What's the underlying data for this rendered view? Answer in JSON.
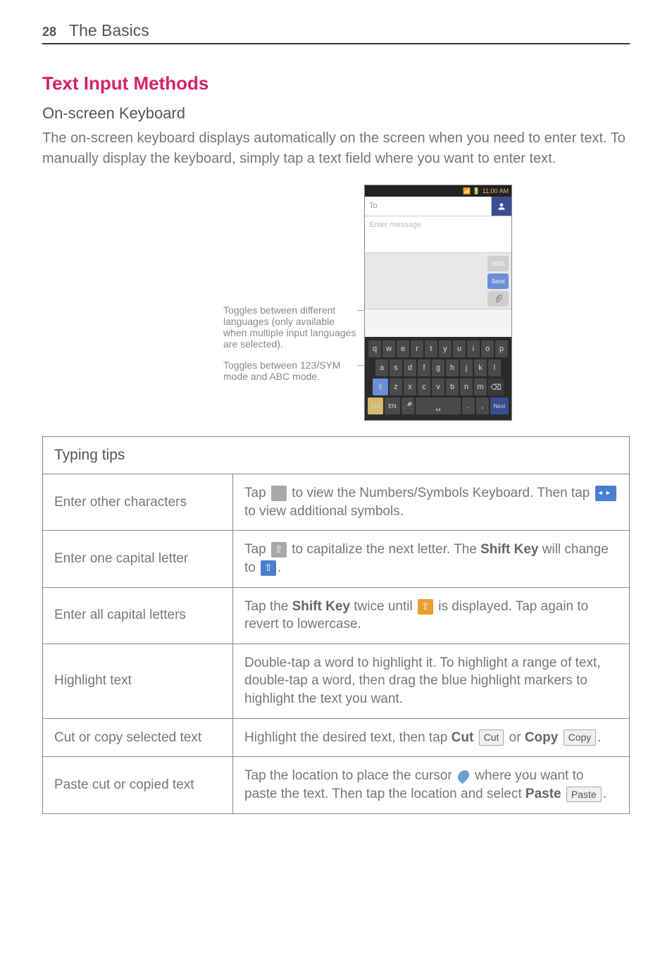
{
  "page_number": "28",
  "section_title": "The Basics",
  "heading": "Text Input Methods",
  "sub_heading": "On-screen Keyboard",
  "intro": "The on-screen keyboard displays automatically on the screen when you need to enter text. To manually display the keyboard, simply tap a text field where you want to enter text.",
  "annotations": {
    "lang": "Toggles between different languages (only available when multiple input languages are selected).",
    "sym": "Toggles between 123/SYM mode and ABC mode."
  },
  "phone": {
    "status_time": "11:00 AM",
    "to_placeholder": "To",
    "msg_placeholder": "Enter message",
    "char_count": "160/1",
    "send": "Send",
    "keys_r1": [
      "q",
      "w",
      "e",
      "r",
      "t",
      "y",
      "u",
      "i",
      "o",
      "p"
    ],
    "keys_r2": [
      "a",
      "s",
      "d",
      "f",
      "g",
      "h",
      "j",
      "k",
      "l"
    ],
    "keys_r3": [
      "z",
      "x",
      "c",
      "v",
      "b",
      "n",
      "m"
    ],
    "sym_key": "123",
    "lang_key": "EN",
    "next_key": "Next"
  },
  "table": {
    "header": "Typing tips",
    "rows": [
      {
        "label": "Enter other characters",
        "text_pre": "Tap ",
        "text_mid": " to view the Numbers/Symbols Keyboard. Then tap ",
        "text_post": " to view additional symbols."
      },
      {
        "label": "Enter one capital letter",
        "text_pre": "Tap ",
        "text_mid": " to capitalize the next letter. The ",
        "key_bold": "Shift Key",
        "text_post": " will change to ",
        "text_end": "."
      },
      {
        "label": "Enter all capital letters",
        "text_pre": "Tap the ",
        "key_bold": "Shift Key",
        "text_mid": " twice until ",
        "text_post": " is displayed. Tap again to revert to lowercase."
      },
      {
        "label": "Highlight text",
        "full": "Double-tap a word to highlight it. To highlight a range of text, double-tap a word, then drag the blue highlight markers to highlight the text you want."
      },
      {
        "label": "Cut or copy selected text",
        "text_pre": "Highlight the desired text, then tap ",
        "cut_bold": "Cut",
        "cut_btn": "Cut",
        "text_mid": " or ",
        "copy_bold": "Copy",
        "copy_btn": "Copy",
        "text_end": "."
      },
      {
        "label": "Paste cut or copied text",
        "text_pre": "Tap the location to place the cursor ",
        "text_mid": " where you want to paste the text. Then tap the location and select ",
        "paste_bold": "Paste",
        "paste_btn": "Paste",
        "text_end": "."
      }
    ]
  }
}
